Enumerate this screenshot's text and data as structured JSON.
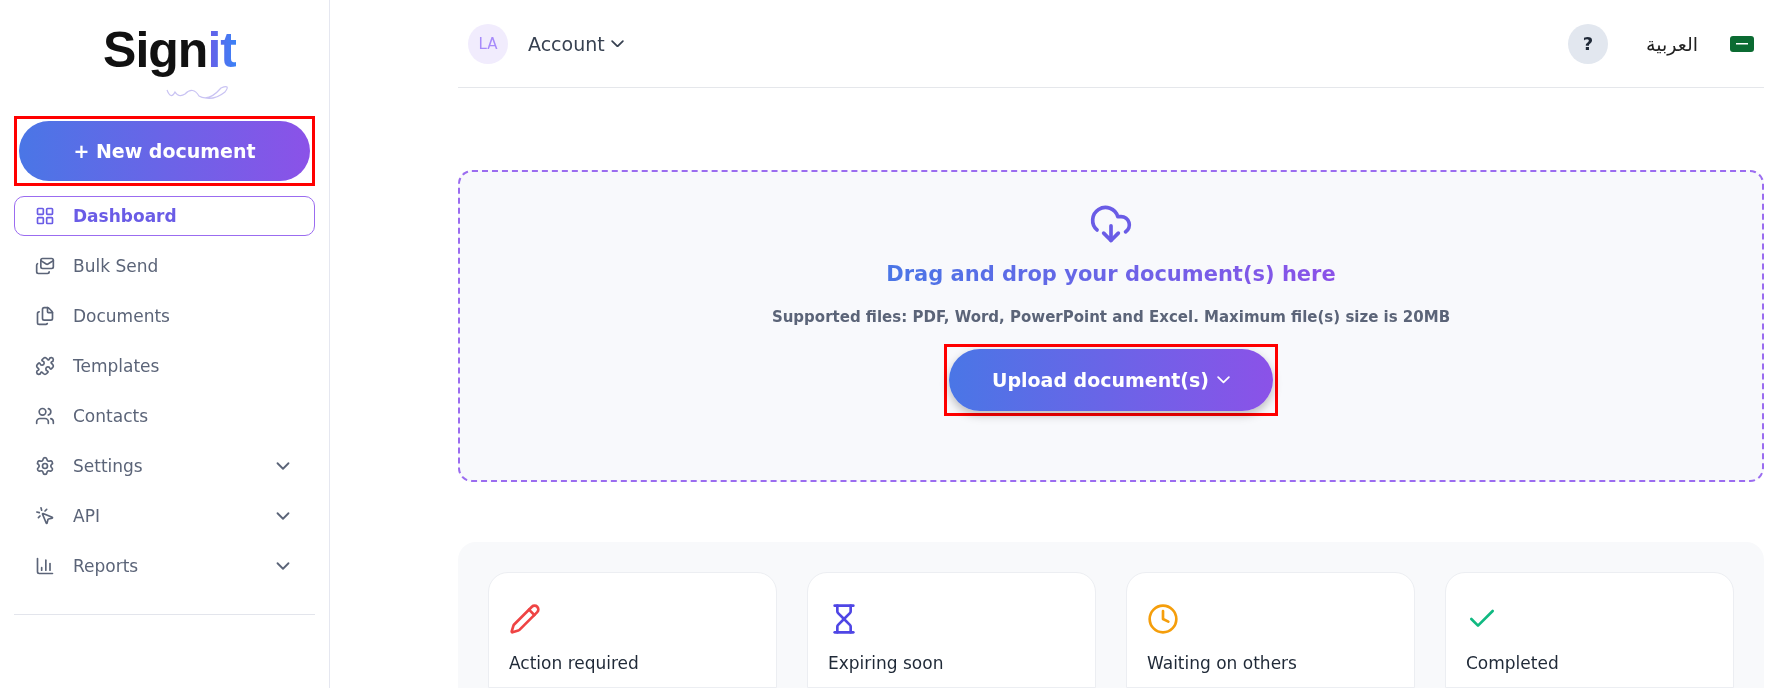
{
  "logo": {
    "text": "Sign",
    "accent": "it"
  },
  "new_document": {
    "label": "+ New document",
    "highlighted": true
  },
  "sidebar": {
    "items": [
      {
        "label": "Dashboard",
        "kind": "dashboard",
        "selected": true,
        "expandable": false
      },
      {
        "label": "Bulk Send",
        "kind": "bulk",
        "selected": false,
        "expandable": false
      },
      {
        "label": "Documents",
        "kind": "documents",
        "selected": false,
        "expandable": false
      },
      {
        "label": "Templates",
        "kind": "templates",
        "selected": false,
        "expandable": false
      },
      {
        "label": "Contacts",
        "kind": "contacts",
        "selected": false,
        "expandable": false
      },
      {
        "label": "Settings",
        "kind": "settings",
        "selected": false,
        "expandable": true
      },
      {
        "label": "API",
        "kind": "api",
        "selected": false,
        "expandable": true
      },
      {
        "label": "Reports",
        "kind": "reports",
        "selected": false,
        "expandable": true
      }
    ]
  },
  "header": {
    "avatar": "LA",
    "account": "Account",
    "help": "?",
    "language": "العربية"
  },
  "dropzone": {
    "title": "Drag and drop your document(s) here",
    "subtitle": "Supported files: PDF, Word, PowerPoint and Excel. Maximum file(s) size is 20MB",
    "button": {
      "label": "Upload document(s)",
      "highlighted": true
    }
  },
  "cards": [
    {
      "label": "Action required",
      "kind": "action",
      "color": "#ef4444"
    },
    {
      "label": "Expiring soon",
      "kind": "expiring",
      "color": "#4f46e5"
    },
    {
      "label": "Waiting on others",
      "kind": "waiting",
      "color": "#f59e0b"
    },
    {
      "label": "Completed",
      "kind": "completed",
      "color": "#10b981"
    }
  ]
}
